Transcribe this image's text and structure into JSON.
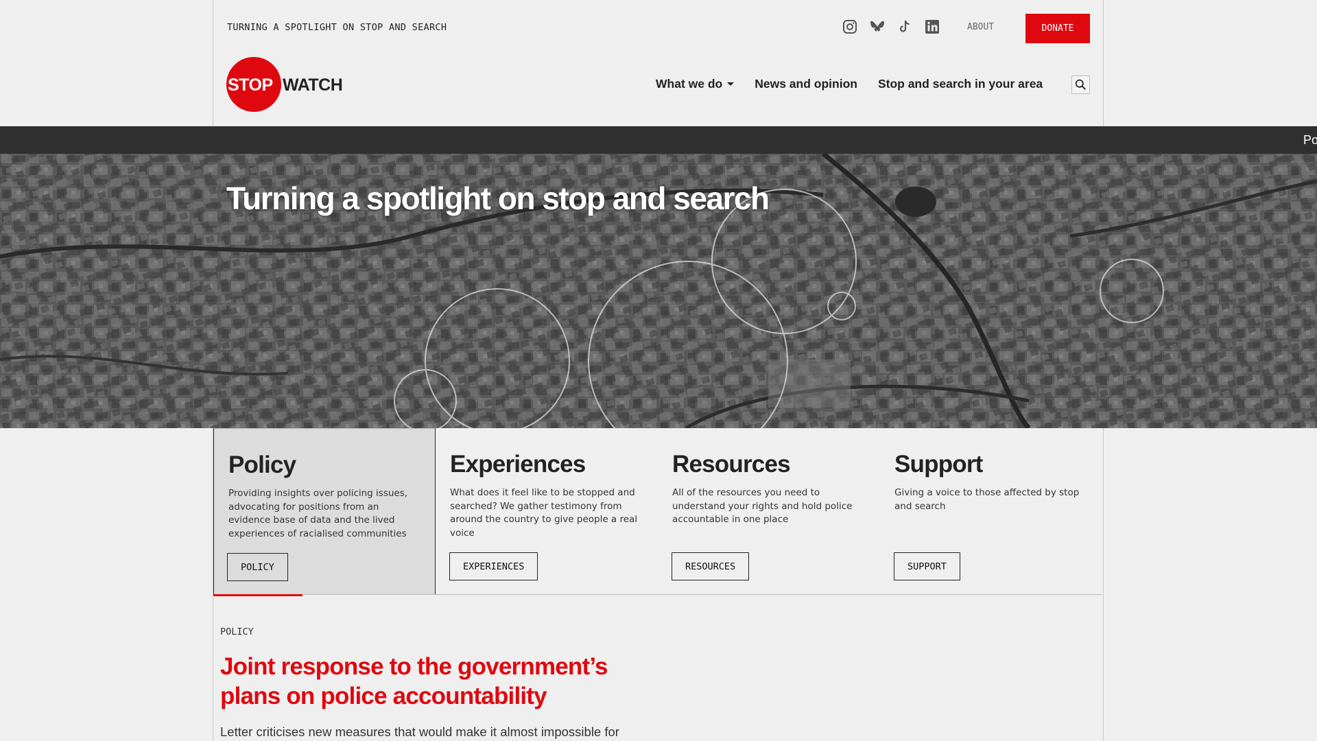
{
  "header": {
    "tagline": "TURNING A SPOTLIGHT ON STOP AND SEARCH",
    "social": [
      "instagram-icon",
      "bluesky-icon",
      "tiktok-icon",
      "linkedin-icon"
    ],
    "about_label": "ABOUT",
    "donate_label": "DONATE"
  },
  "logo": {
    "part1": "STOP",
    "part2": "WATCH"
  },
  "nav": {
    "items": [
      {
        "label": "What we do",
        "dropdown": true
      },
      {
        "label": "News and opinion"
      },
      {
        "label": "Stop and search in your area"
      }
    ],
    "search_icon": "search-icon"
  },
  "ticker": {
    "text": "Po"
  },
  "hero": {
    "title": "Turning a spotlight on stop and search"
  },
  "cards": [
    {
      "title": "Policy",
      "text": "Providing insights over policing issues, advocating for positions from an evidence base of data and the lived experiences of racialised communities",
      "button": "POLICY",
      "active": true
    },
    {
      "title": "Experiences",
      "text": "What does it feel like to be stopped and searched? We gather testimony from around the country to give people a real voice",
      "button": "EXPERIENCES"
    },
    {
      "title": "Resources",
      "text": "All of the resources you need to understand your rights and hold police accountable in one place",
      "button": "RESOURCES"
    },
    {
      "title": "Support",
      "text": "Giving a voice to those affected by stop and search",
      "button": "SUPPORT"
    }
  ],
  "article": {
    "kicker": "POLICY",
    "headline": "Joint response to the government’s plans on police accountability",
    "summary": "Letter criticises new measures that would make it almost impossible for"
  },
  "colors": {
    "accent": "#e0080f",
    "ticker_bg": "#2f2f2f",
    "page_bg": "#efefef"
  }
}
